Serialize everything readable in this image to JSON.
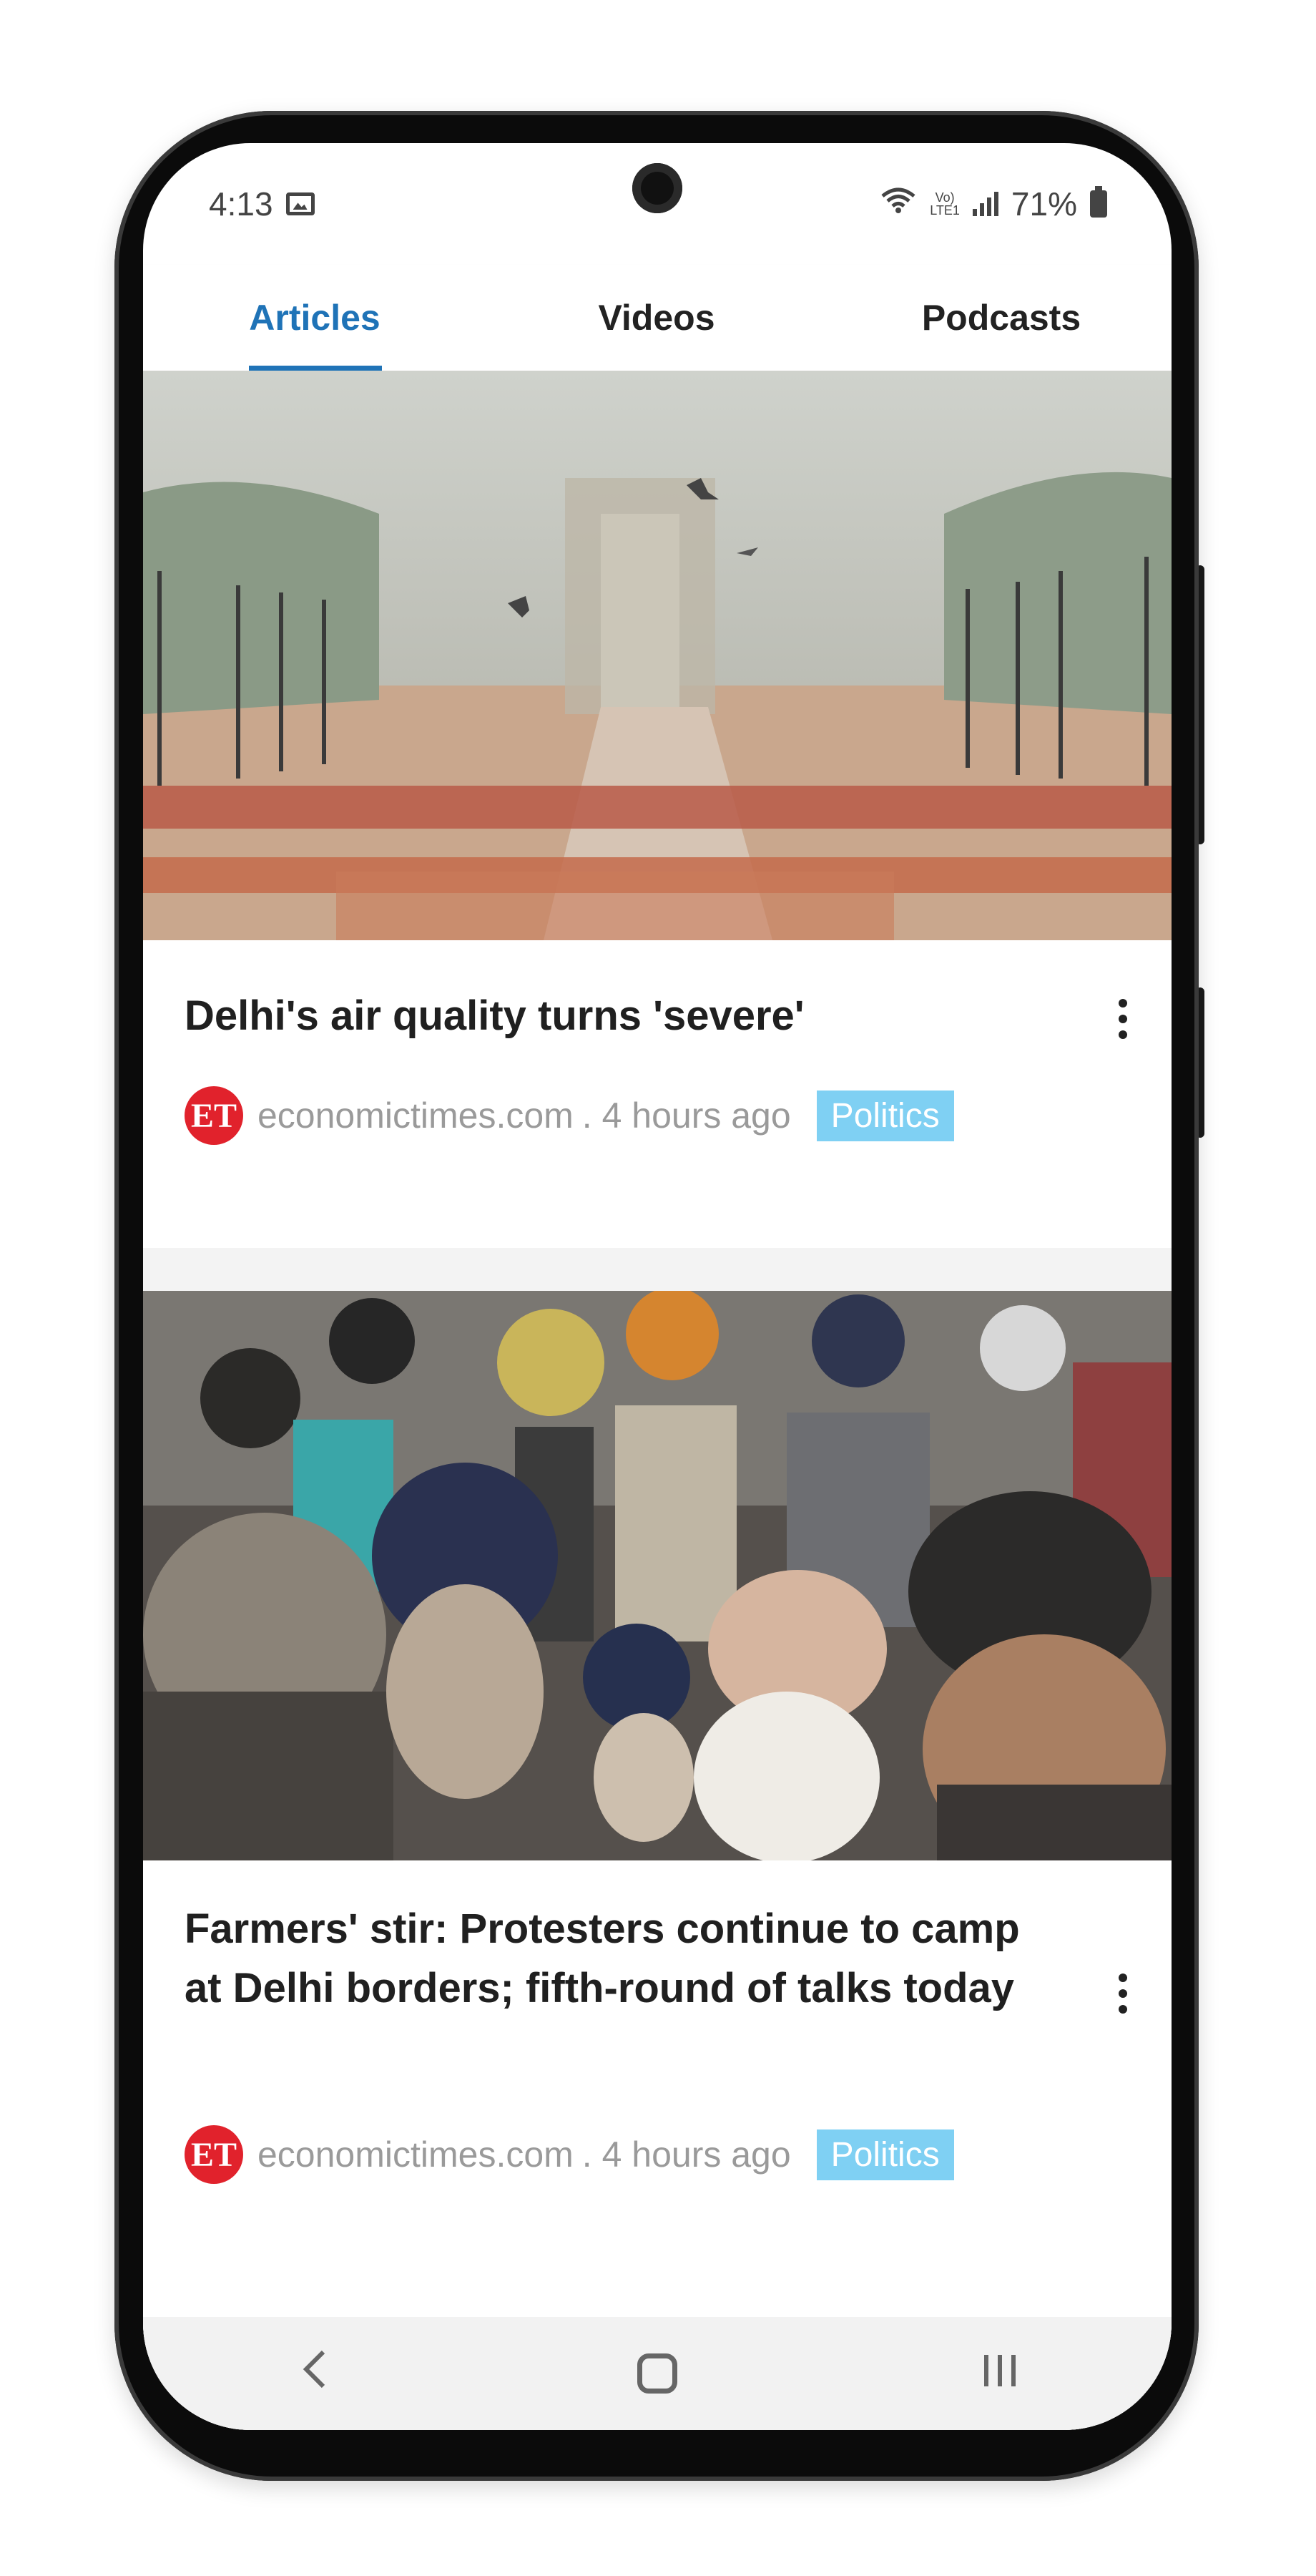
{
  "status_bar": {
    "time": "4:13",
    "volte_top": "Vo)",
    "volte_bottom": "LTE1",
    "battery": "71%"
  },
  "tabs": [
    {
      "label": "Articles",
      "active": true
    },
    {
      "label": "Videos",
      "active": false
    },
    {
      "label": "Podcasts",
      "active": false
    }
  ],
  "articles": [
    {
      "headline": "Delhi's air quality turns 'severe'",
      "source_logo": "ET",
      "source": "economictimes.com",
      "time": ". 4 hours ago",
      "category": "Politics"
    },
    {
      "headline": "Farmers' stir: Protesters continue to camp at Delhi borders; fifth-round of talks today",
      "source_logo": "ET",
      "source": "economictimes.com",
      "time": ". 4 hours ago",
      "category": "Politics"
    }
  ],
  "nav": {
    "back_icon": "back-chevron-icon",
    "home_icon": "home-icon",
    "recents_icon": "recents-icon"
  },
  "colors": {
    "accent": "#1f73b7",
    "badge": "#7fd0f3",
    "source_logo": "#e1222c"
  }
}
